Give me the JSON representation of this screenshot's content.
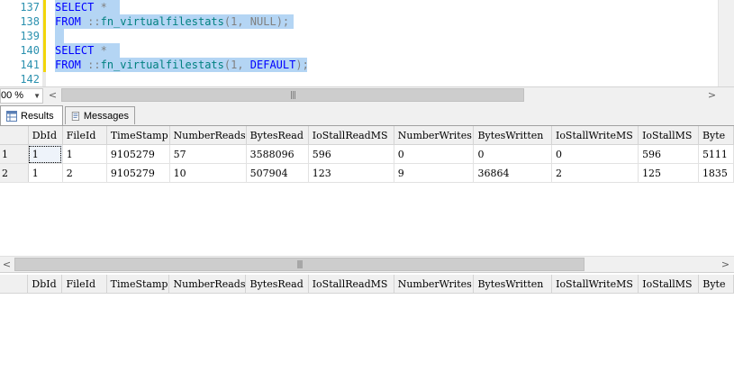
{
  "editor": {
    "lines": [
      {
        "num": "137"
      },
      {
        "num": "138"
      },
      {
        "num": "139"
      },
      {
        "num": "140"
      },
      {
        "num": "141"
      },
      {
        "num": "142"
      }
    ],
    "code": {
      "l1_select": "SELECT",
      "l1_star": " *",
      "l2_from": "FROM",
      "l2_sep": " ::",
      "l2_fn": "fn_virtualfilestats",
      "l2_args_open": "(1, ",
      "l2_null": "NULL",
      "l2_close": ");",
      "l4_select": "SELECT",
      "l4_star": " *",
      "l5_from": "FROM",
      "l5_sep": " ::",
      "l5_fn": "fn_virtualfilestats",
      "l5_args_open": "(1, ",
      "l5_default": "DEFAULT",
      "l5_close": ");"
    },
    "selection_color": "#b4d5f4",
    "zoom": "00 %",
    "zoom_arrow": "▼",
    "scroll_left": "<",
    "scroll_right": ">",
    "thumb_grip": "|||"
  },
  "tabs": [
    {
      "label": "Results",
      "icon": "results-grid-icon"
    },
    {
      "label": "Messages",
      "icon": "messages-icon"
    }
  ],
  "grid1": {
    "columns": [
      "DbId",
      "FileId",
      "TimeStamp",
      "NumberReads",
      "BytesRead",
      "IoStallReadMS",
      "NumberWrites",
      "BytesWritten",
      "IoStallWriteMS",
      "IoStallMS",
      "Byte"
    ],
    "rows": [
      {
        "num": "1",
        "cells": [
          "1",
          "1",
          "9105279",
          "57",
          "3588096",
          "596",
          "0",
          "0",
          "0",
          "596",
          "5111"
        ]
      },
      {
        "num": "2",
        "cells": [
          "1",
          "2",
          "9105279",
          "10",
          "507904",
          "123",
          "9",
          "36864",
          "2",
          "125",
          "1835"
        ]
      }
    ]
  },
  "grid2": {
    "columns": [
      "DbId",
      "FileId",
      "TimeStamp",
      "NumberReads",
      "BytesRead",
      "IoStallReadMS",
      "NumberWrites",
      "BytesWritten",
      "IoStallWriteMS",
      "IoStallMS",
      "Byte"
    ]
  },
  "scroll": {
    "left": "<",
    "right": ">",
    "grip": "|||"
  }
}
